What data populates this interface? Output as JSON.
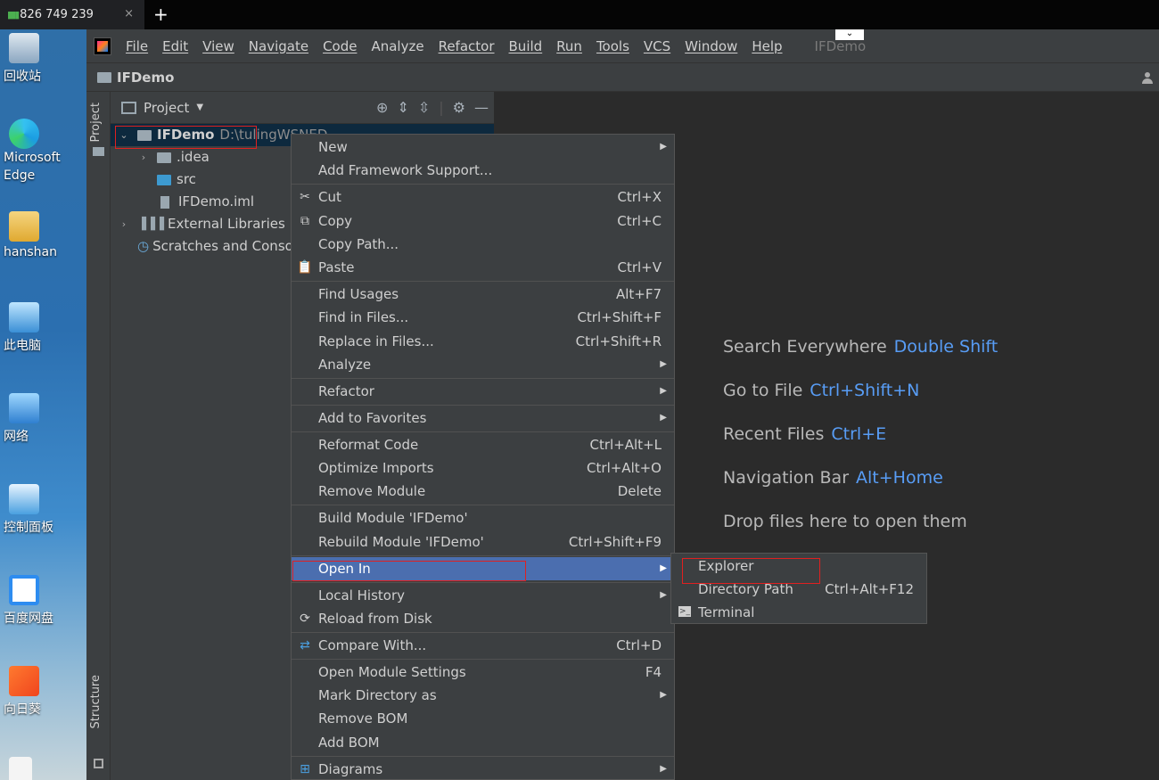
{
  "remote_tab": {
    "label": "826 749 239",
    "close": "×",
    "new_tab": "+"
  },
  "desktop": {
    "icons": [
      {
        "label": "回收站"
      },
      {
        "label": "Microsoft\nEdge"
      },
      {
        "label": "hanshan"
      },
      {
        "label": "此电脑"
      },
      {
        "label": "网络"
      },
      {
        "label": "控制面板"
      },
      {
        "label": "百度网盘"
      },
      {
        "label": "向日葵"
      }
    ]
  },
  "menubar": {
    "items": [
      "File",
      "Edit",
      "View",
      "Navigate",
      "Code",
      "Analyze",
      "Refactor",
      "Build",
      "Run",
      "Tools",
      "VCS",
      "Window",
      "Help"
    ],
    "project_name": "IFDemo"
  },
  "navbar": {
    "project": "IFDemo"
  },
  "sidebar": {
    "project_tab": "Project",
    "structure_tab": "Structure"
  },
  "project_panel": {
    "title": "Project",
    "tree": {
      "root_name": "IFDemo",
      "root_path": "D:\\tulingWSNED",
      "idea": ".idea",
      "src": "src",
      "iml": "IFDemo.iml",
      "external": "External Libraries",
      "scratches": "Scratches and Consoles"
    }
  },
  "welcome": {
    "lines": [
      {
        "label": "Search Everywhere",
        "key": "Double Shift"
      },
      {
        "label": "Go to File",
        "key": "Ctrl+Shift+N"
      },
      {
        "label": "Recent Files",
        "key": "Ctrl+E"
      },
      {
        "label": "Navigation Bar",
        "key": "Alt+Home"
      }
    ],
    "drop": "Drop files here to open them"
  },
  "context_menu": {
    "new": "New",
    "add_framework": "Add Framework Support...",
    "cut": "Cut",
    "cut_sc": "Ctrl+X",
    "copy": "Copy",
    "copy_sc": "Ctrl+C",
    "copy_path": "Copy Path...",
    "paste": "Paste",
    "paste_sc": "Ctrl+V",
    "find_usages": "Find Usages",
    "find_usages_sc": "Alt+F7",
    "find_in_files": "Find in Files...",
    "find_in_files_sc": "Ctrl+Shift+F",
    "replace_in_files": "Replace in Files...",
    "replace_in_files_sc": "Ctrl+Shift+R",
    "analyze": "Analyze",
    "refactor": "Refactor",
    "add_favorites": "Add to Favorites",
    "reformat": "Reformat Code",
    "reformat_sc": "Ctrl+Alt+L",
    "optimize": "Optimize Imports",
    "optimize_sc": "Ctrl+Alt+O",
    "remove_module": "Remove Module",
    "remove_module_sc": "Delete",
    "build_module": "Build Module 'IFDemo'",
    "rebuild_module": "Rebuild Module 'IFDemo'",
    "rebuild_module_sc": "Ctrl+Shift+F9",
    "open_in": "Open In",
    "local_history": "Local History",
    "reload": "Reload from Disk",
    "compare": "Compare With...",
    "compare_sc": "Ctrl+D",
    "module_settings": "Open Module Settings",
    "module_settings_sc": "F4",
    "mark_directory": "Mark Directory as",
    "remove_bom": "Remove BOM",
    "add_bom": "Add BOM",
    "diagrams": "Diagrams"
  },
  "submenu": {
    "explorer": "Explorer",
    "directory_path": "Directory Path",
    "directory_path_sc": "Ctrl+Alt+F12",
    "terminal": "Terminal"
  }
}
